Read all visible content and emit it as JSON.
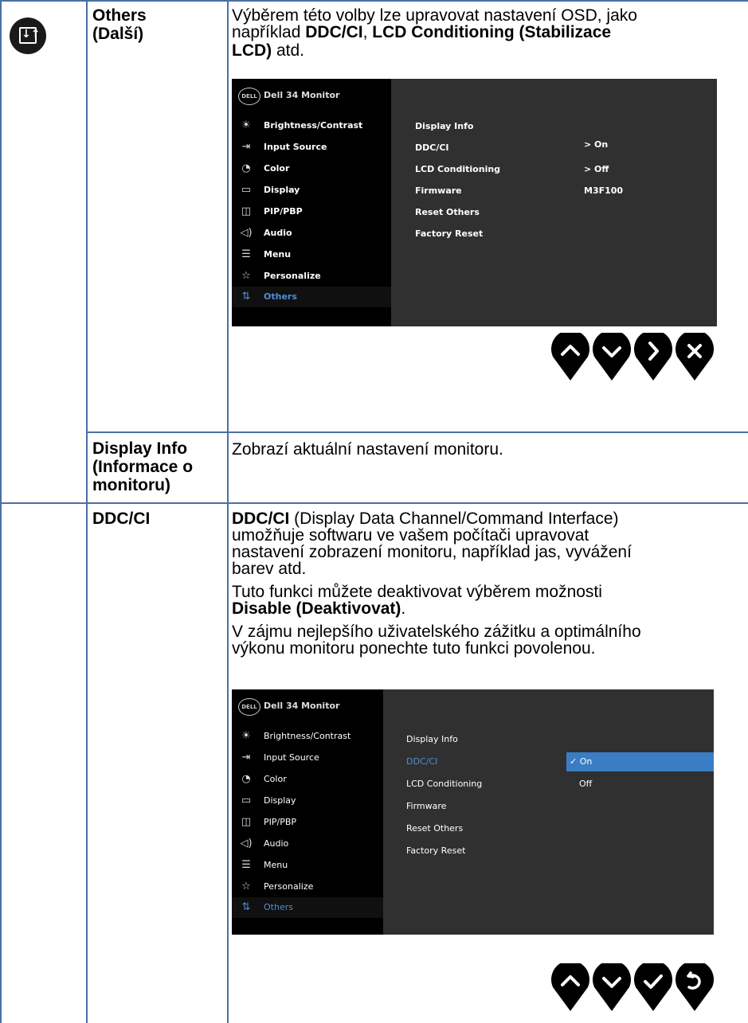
{
  "row1": {
    "title_line1": "Others",
    "title_line2": "(Další)",
    "icon": "others-icon",
    "desc_line1": "Výběrem této volby lze upravovat nastavení OSD, jako",
    "desc_line2_pre": "například ",
    "desc_line2_b1": "DDC/CI",
    "desc_line2_sep": ", ",
    "desc_line2_b2": "LCD Conditioning (Stabilizace",
    "desc_line3_b": "LCD)",
    "desc_line3_post": " atd."
  },
  "osd1": {
    "logo": "DELL",
    "model": "Dell 34 Monitor",
    "menu": [
      {
        "icon": "brightness-icon",
        "label": "Brightness/Contrast"
      },
      {
        "icon": "input-source-icon",
        "label": "Input Source"
      },
      {
        "icon": "color-icon",
        "label": "Color"
      },
      {
        "icon": "display-icon",
        "label": "Display"
      },
      {
        "icon": "pip-pbp-icon",
        "label": "PIP/PBP"
      },
      {
        "icon": "audio-icon",
        "label": "Audio"
      },
      {
        "icon": "menu-icon",
        "label": "Menu"
      },
      {
        "icon": "star-icon",
        "label": "Personalize"
      },
      {
        "icon": "others-icon",
        "label": "Others"
      }
    ],
    "items": [
      "Display Info",
      "DDC/CI",
      "LCD Conditioning",
      "Firmware",
      "Reset Others",
      "Factory Reset"
    ],
    "values": {
      "ddc": "> On",
      "lcd": "> Off",
      "firmware": "M3F100"
    },
    "buttons": [
      "up-icon",
      "down-icon",
      "right-icon",
      "close-icon"
    ]
  },
  "row2": {
    "title_line1": "Display Info",
    "title_line2": "(Informace o",
    "title_line3": "monitoru)",
    "desc": "Zobrazí aktuální nastavení monitoru."
  },
  "row3": {
    "title": "DDC/CI",
    "p1_b": "DDC/CI",
    "p1_l1": " (Display Data Channel/Command Interface)",
    "p1_l2": "umožňuje softwaru ve vašem počítači upravovat",
    "p1_l3": "nastavení zobrazení monitoru, například jas, vyvážení",
    "p1_l4": "barev atd.",
    "p2_l1": "Tuto funkci můžete deaktivovat výběrem možnosti",
    "p2_b": "Disable (Deaktivovat)",
    "p2_end": ".",
    "p3_l1": "V zájmu nejlepšího uživatelského zážitku a optimálního",
    "p3_l2": "výkonu monitoru ponechte tuto funkci povolenou."
  },
  "osd2": {
    "logo": "DELL",
    "model": "Dell 34 Monitor",
    "menu": [
      {
        "icon": "brightness-icon",
        "label": "Brightness/Contrast"
      },
      {
        "icon": "input-source-icon",
        "label": "Input Source"
      },
      {
        "icon": "color-icon",
        "label": "Color"
      },
      {
        "icon": "display-icon",
        "label": "Display"
      },
      {
        "icon": "pip-pbp-icon",
        "label": "PIP/PBP"
      },
      {
        "icon": "audio-icon",
        "label": "Audio"
      },
      {
        "icon": "menu-icon",
        "label": "Menu"
      },
      {
        "icon": "star-icon",
        "label": "Personalize"
      },
      {
        "icon": "others-icon",
        "label": "Others"
      }
    ],
    "items": [
      "Display Info",
      "DDC/CI",
      "LCD Conditioning",
      "Firmware",
      "Reset Others",
      "Factory Reset"
    ],
    "values": {
      "on": "✓ On",
      "off": "Off"
    },
    "buttons": [
      "up-icon",
      "down-icon",
      "check-icon",
      "back-icon"
    ]
  },
  "colors": {
    "border": "#4a6fa5",
    "osd_bg": "#303030",
    "highlight": "#3b7dc4",
    "selected_text": "#4d8fd6"
  }
}
